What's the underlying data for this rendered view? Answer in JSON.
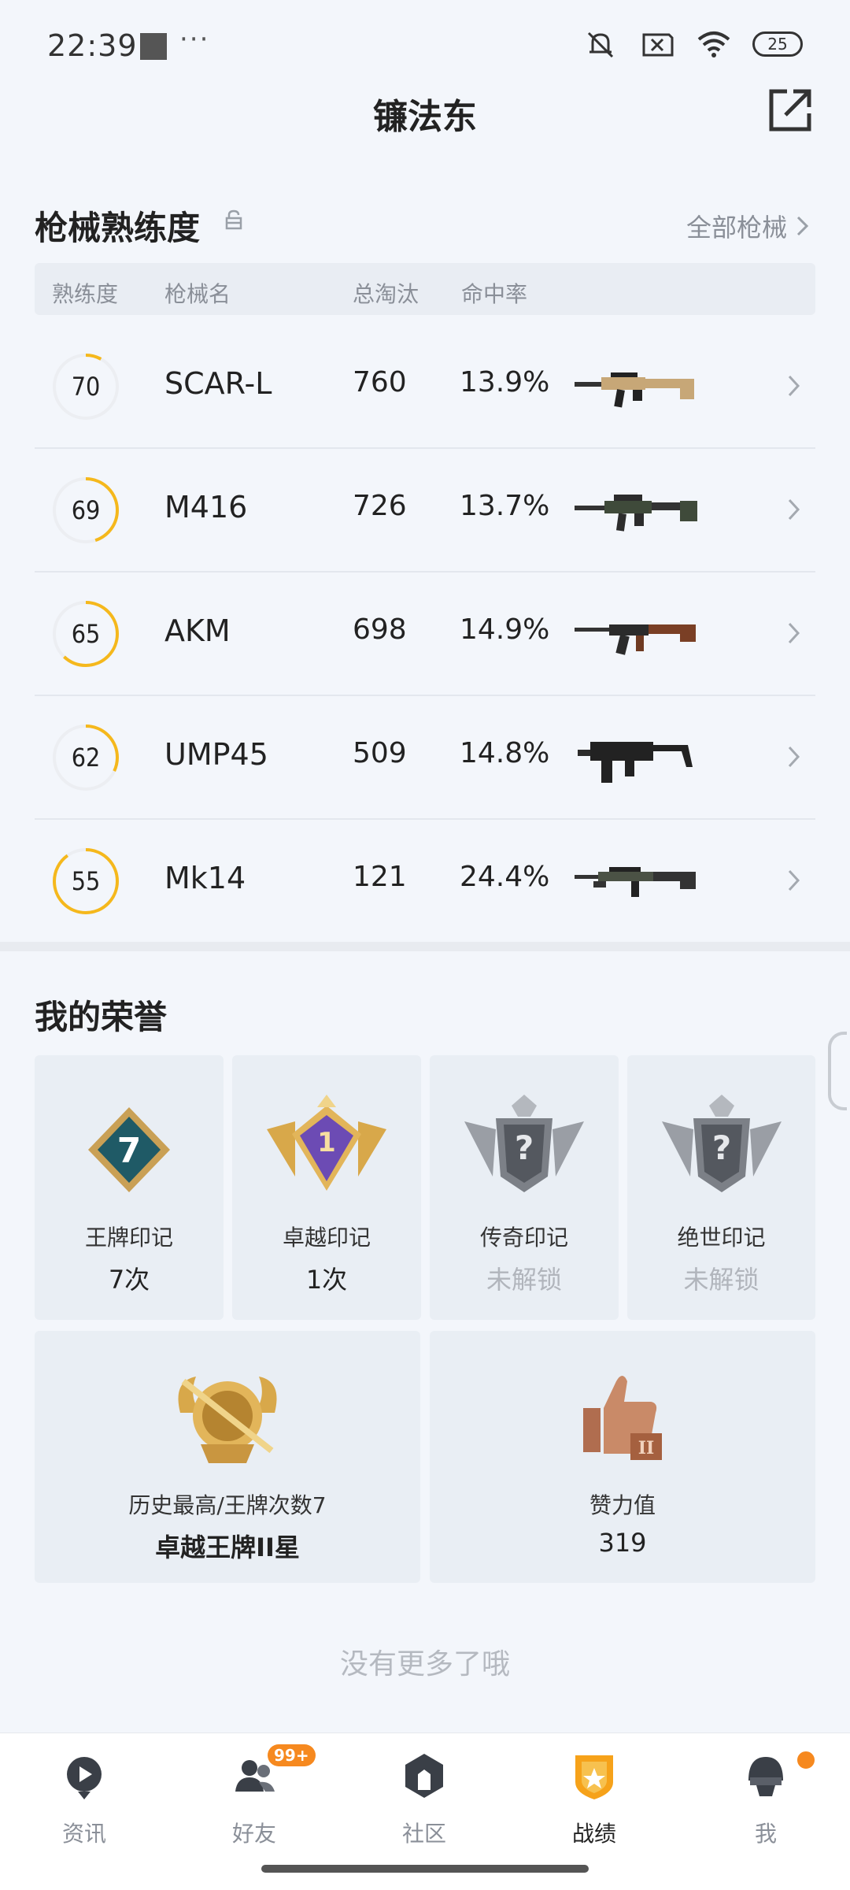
{
  "status_bar": {
    "time": "22:39",
    "dots": "···",
    "battery": "25"
  },
  "header": {
    "title": "镰法东"
  },
  "weapons": {
    "title": "枪械熟练度",
    "all_link": "全部枪械",
    "columns": {
      "mastery": "熟练度",
      "name": "枪械名",
      "kills": "总淘汰",
      "accuracy": "命中率"
    },
    "rows": [
      {
        "mastery": "70",
        "name": "SCAR-L",
        "kills": "760",
        "accuracy": "13.9%",
        "progress": 0.08
      },
      {
        "mastery": "69",
        "name": "M416",
        "kills": "726",
        "accuracy": "13.7%",
        "progress": 0.45
      },
      {
        "mastery": "65",
        "name": "AKM",
        "kills": "698",
        "accuracy": "14.9%",
        "progress": 0.62
      },
      {
        "mastery": "62",
        "name": "UMP45",
        "kills": "509",
        "accuracy": "14.8%",
        "progress": 0.32
      },
      {
        "mastery": "55",
        "name": "Mk14",
        "kills": "121",
        "accuracy": "24.4%",
        "progress": 0.9
      }
    ]
  },
  "honors": {
    "title": "我的荣誉",
    "badges": [
      {
        "label": "王牌印记",
        "value": "7次",
        "badge_text": "7"
      },
      {
        "label": "卓越印记",
        "value": "1次",
        "badge_text": "1"
      },
      {
        "label": "传奇印记",
        "value": "未解锁",
        "badge_text": "?"
      },
      {
        "label": "绝世印记",
        "value": "未解锁",
        "badge_text": "?"
      }
    ],
    "best": {
      "label": "历史最高/王牌次数7",
      "value": "卓越王牌II星"
    },
    "likes": {
      "label": "赞力值",
      "value": "319"
    }
  },
  "footer": {
    "no_more": "没有更多了哦"
  },
  "nav": [
    {
      "label": "资讯"
    },
    {
      "label": "好友",
      "badge": "99+"
    },
    {
      "label": "社区"
    },
    {
      "label": "战绩"
    },
    {
      "label": "我"
    }
  ],
  "colors": {
    "accent": "#f5b81c",
    "nav_active": "#f6a21a",
    "badge": "#f6891f"
  }
}
